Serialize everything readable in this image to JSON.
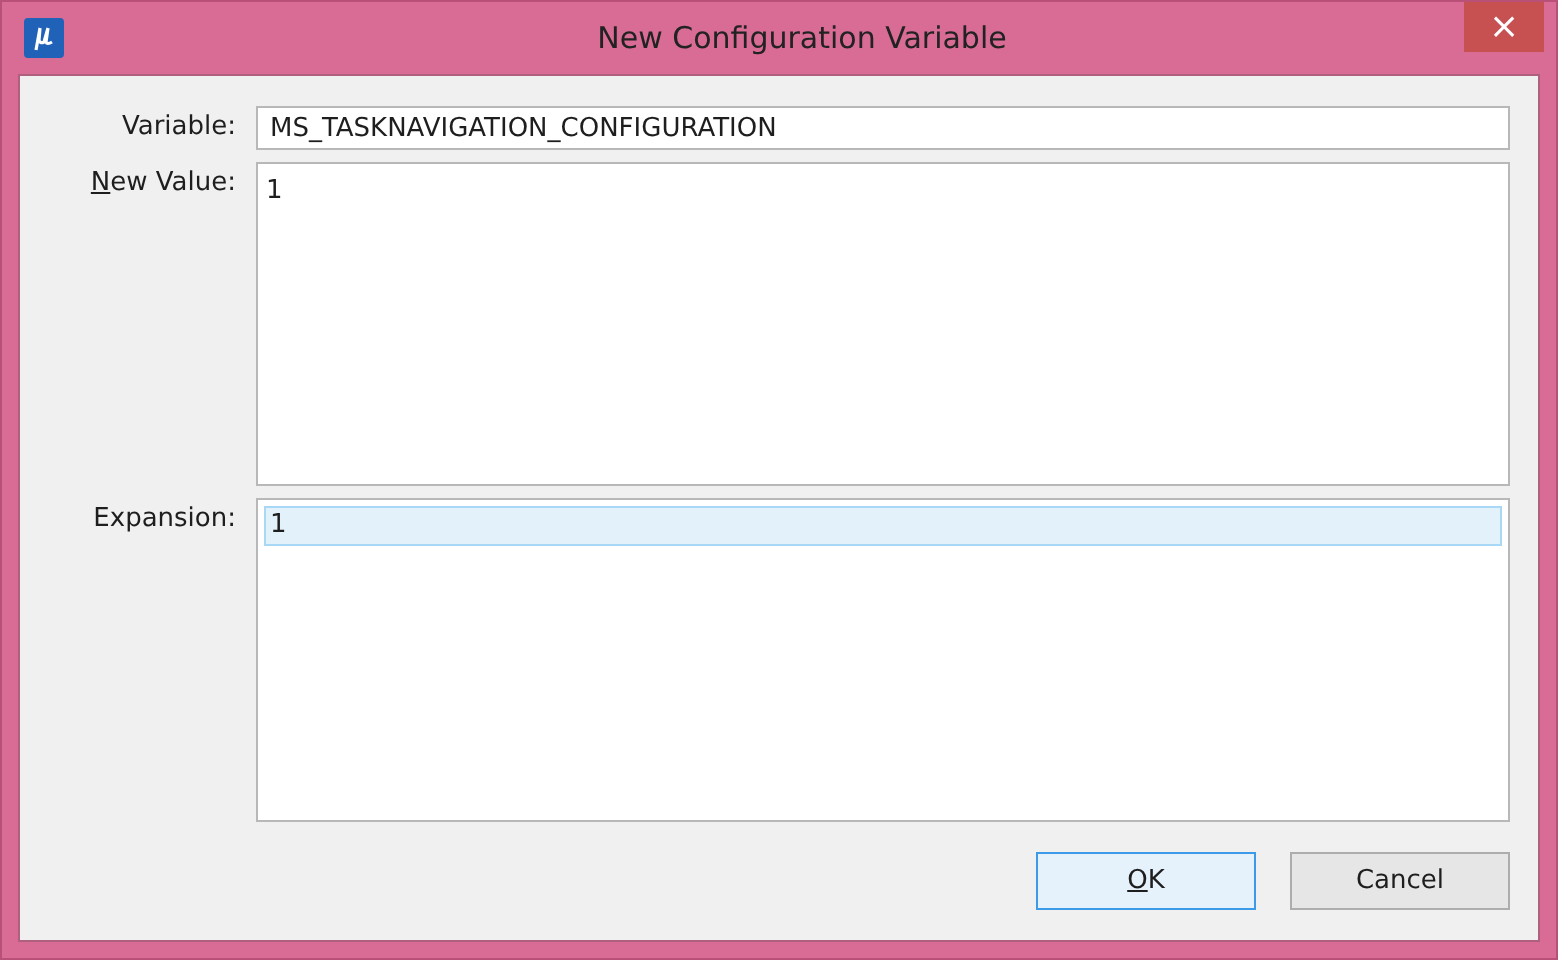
{
  "window": {
    "title": "New Configuration Variable",
    "close": "×"
  },
  "fields": [
    {
      "label": "Variable:",
      "access_key": false,
      "kind": "line",
      "value": "MS_TASKNAVIGATION_CONFIGURATION"
    },
    {
      "label": "New Value:",
      "access_key": true,
      "kind": "text",
      "value": "1"
    },
    {
      "label": "Expansion:",
      "access_key": false,
      "kind": "list",
      "rows": [
        {
          "text": "1",
          "selected": true
        }
      ]
    }
  ],
  "buttons": [
    {
      "label": "OK",
      "access_key": true,
      "default": true
    },
    {
      "label": "Cancel",
      "access_key": false,
      "default": false
    }
  ]
}
